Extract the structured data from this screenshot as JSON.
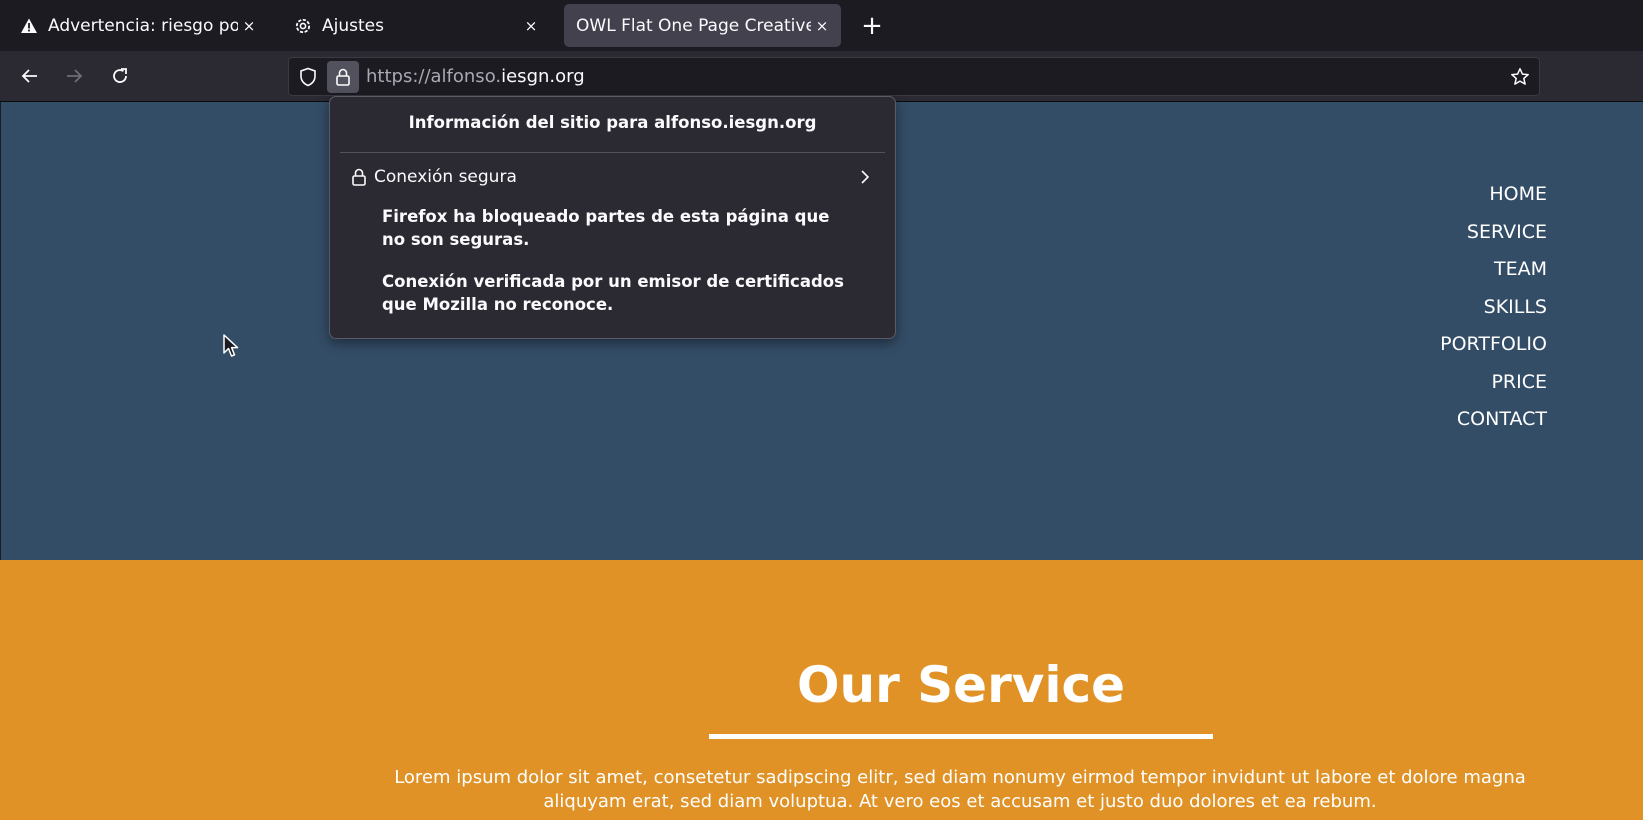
{
  "tabs": [
    {
      "title": "Advertencia: riesgo poten",
      "icon": "warning-icon",
      "active": false
    },
    {
      "title": "Ajustes",
      "icon": "gear-icon",
      "active": false
    },
    {
      "title": "OWL Flat One Page Creative",
      "icon": "",
      "active": true
    }
  ],
  "tab_close_glyph": "×",
  "new_tab_glyph": "+",
  "urlbar": {
    "url_prefix": "https://alfonso.",
    "url_domain": "iesgn.org"
  },
  "site_info_popup": {
    "title": "Información del sitio para alfonso.iesgn.org",
    "connection_label": "Conexión segura",
    "message_1": "Firefox ha bloqueado partes de esta página que no son seguras.",
    "message_2": "Conexión verificada por un emisor de certificados que Mozilla no reconoce."
  },
  "site_menu": [
    "HOME",
    "SERVICE",
    "TEAM",
    "SKILLS",
    "PORTFOLIO",
    "PRICE",
    "CONTACT"
  ],
  "service_section": {
    "title": "Our Service",
    "text": "Lorem ipsum dolor sit amet, consetetur sadipscing elitr, sed diam nonumy eirmod tempor invidunt ut labore et dolore magna aliquyam erat, sed diam voluptua. At vero eos et accusam et justo duo dolores et ea rebum."
  },
  "colors": {
    "hero_bg": "#344d67",
    "service_bg": "#e09226",
    "browser_chrome": "#1c1b22",
    "toolbar": "#2b2a33"
  }
}
